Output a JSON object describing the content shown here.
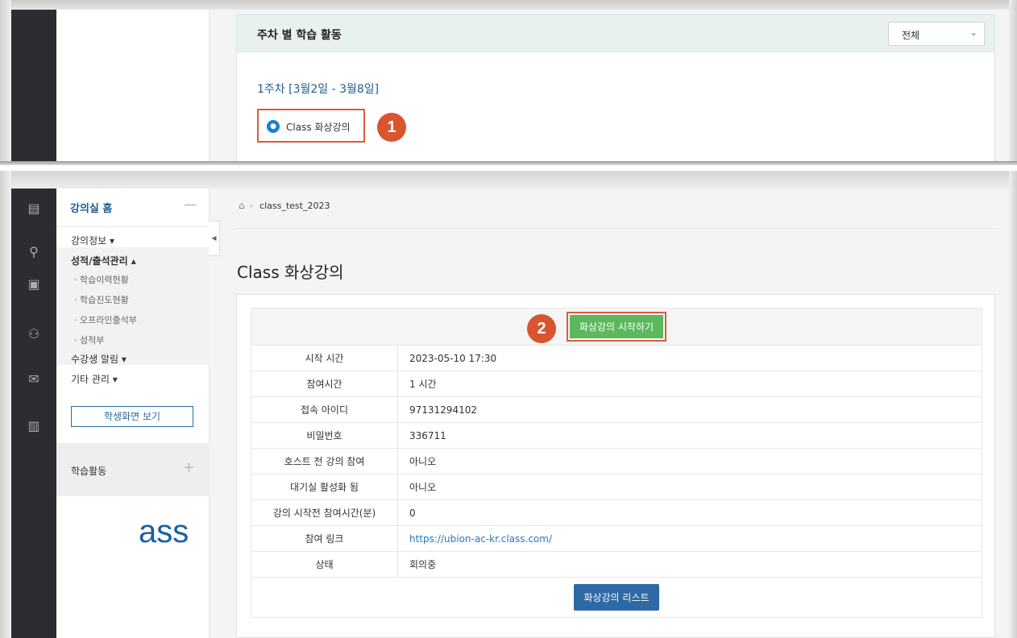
{
  "panel1": {
    "card_title": "주차 별 학습 활동",
    "week_filter": "전체",
    "week_title": "1주차 [3월2일 - 3월8일]",
    "activity_label": "Class 화상강의",
    "step_number": "1"
  },
  "panel2": {
    "sidebar": {
      "home": "강의실 홈",
      "items": {
        "course_info": "강의정보 ▾",
        "grade_attendance": "성적/출석관리 ▴",
        "sub1": "· 학습이력현황",
        "sub2": "· 학습진도현황",
        "sub3": "· 오프라인출석부",
        "sub4": "· 성적부",
        "student_notice": "수강생 알림 ▾",
        "other_mgmt": "기타 관리 ▾"
      },
      "student_view_button": "학생화면 보기",
      "learning_activity": "학습활동",
      "fragment_text": "ass"
    },
    "breadcrumb": {
      "course": "class_test_2023"
    },
    "page_title": "Class 화상강의",
    "start_button": "화상강의 시작하기",
    "step_number": "2",
    "details": [
      {
        "key": "시작 시간",
        "value": "2023-05-10 17:30"
      },
      {
        "key": "참여시간",
        "value": "1 시간"
      },
      {
        "key": "접속 아이디",
        "value": "97131294102"
      },
      {
        "key": "비밀번호",
        "value": "336711"
      },
      {
        "key": "호스트 전 강의 참여",
        "value": "아니오"
      },
      {
        "key": "대기실 활성화 됨",
        "value": "아니오"
      },
      {
        "key": "강의 시작전 참여시간(분)",
        "value": "0"
      },
      {
        "key": "참여 링크",
        "value": "https://ubion-ac-kr.class.com/"
      },
      {
        "key": "상태",
        "value": "회의중"
      }
    ],
    "list_button": "화상강의 리스트"
  },
  "colors": {
    "accent_blue": "#2d6aa3",
    "start_green": "#5cb85c",
    "highlight_red": "#e05a3a",
    "step_badge": "#d9552f",
    "rail_dark": "#2b2d31"
  },
  "icons": [
    "home-icon",
    "video-class-icon",
    "book-icon",
    "person-icon",
    "notebook-icon",
    "people-icon",
    "mail-icon",
    "map-icon"
  ]
}
